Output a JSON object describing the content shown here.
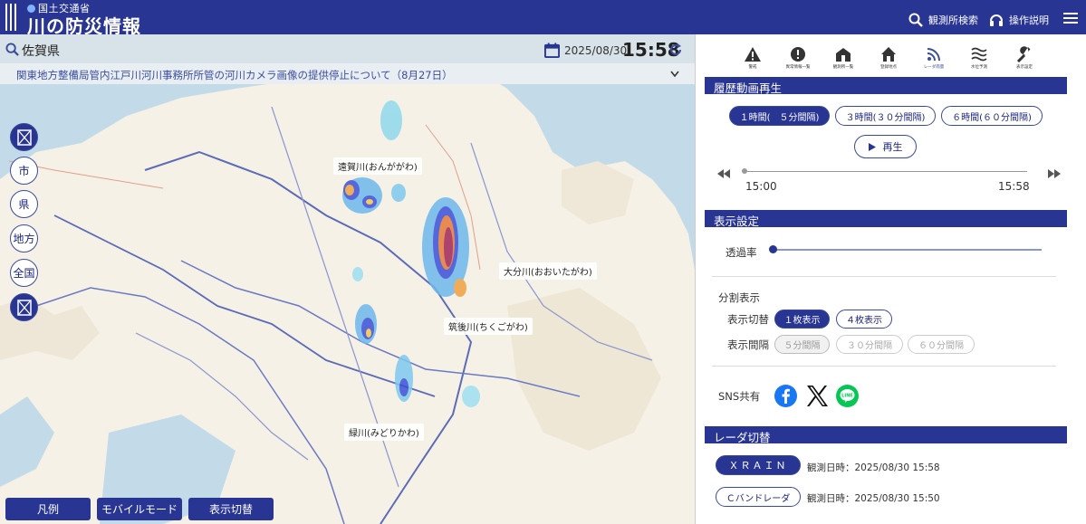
{
  "header": {
    "ministry": "国土交通省",
    "title": "川の防災情報",
    "search_station": "観測所検索",
    "help": "操作説明"
  },
  "location": {
    "name": "佐賀県",
    "date": "2025/08/30",
    "time": "15:58"
  },
  "notice": "関東地方整備局管内江戸川河川事務所所管の河川カメラ画像の提供停止について（8月27日）",
  "map_side_buttons": [
    "市",
    "県",
    "地方",
    "全国"
  ],
  "river_labels": {
    "onga": "遠賀川(おんががわ)",
    "oita": "大分川(おおいたがわ)",
    "chikugo": "筑後川(ちくごがわ)",
    "midori": "緑川(みどりかわ)"
  },
  "bottom_buttons": [
    "凡例",
    "モバイルモード",
    "表示切替"
  ],
  "toolbar": {
    "items": [
      "警戒",
      "異常情報一覧",
      "観測所一覧",
      "登録地点",
      "レーダ雨量",
      "水位予測",
      "表示設定"
    ]
  },
  "history": {
    "header": "履歴動画再生",
    "options": [
      "１時間(　５分間隔)",
      "３時間(３０分間隔)",
      "６時間(６０分間隔)"
    ],
    "play": "再生",
    "start": "15:00",
    "end": "15:58"
  },
  "display": {
    "header": "表示設定",
    "opacity": "透過率",
    "split": "分割表示",
    "switch_label": "表示切替",
    "switch_options": [
      "１枚表示",
      "４枚表示"
    ],
    "interval_label": "表示間隔",
    "interval_options": [
      "５分間隔",
      "３０分間隔",
      "６０分間隔"
    ],
    "sns": "SNS共有"
  },
  "radar": {
    "header": "レーダ切替",
    "xrain": "ＸＲＡＩＮ",
    "xrain_time": "観測日時：2025/08/30 15:58",
    "cband": "Ｃバンドレーダ",
    "cband_time": "観測日時：2025/08/30 15:50"
  },
  "colors": {
    "brand": "#283593",
    "header": "#283593"
  }
}
